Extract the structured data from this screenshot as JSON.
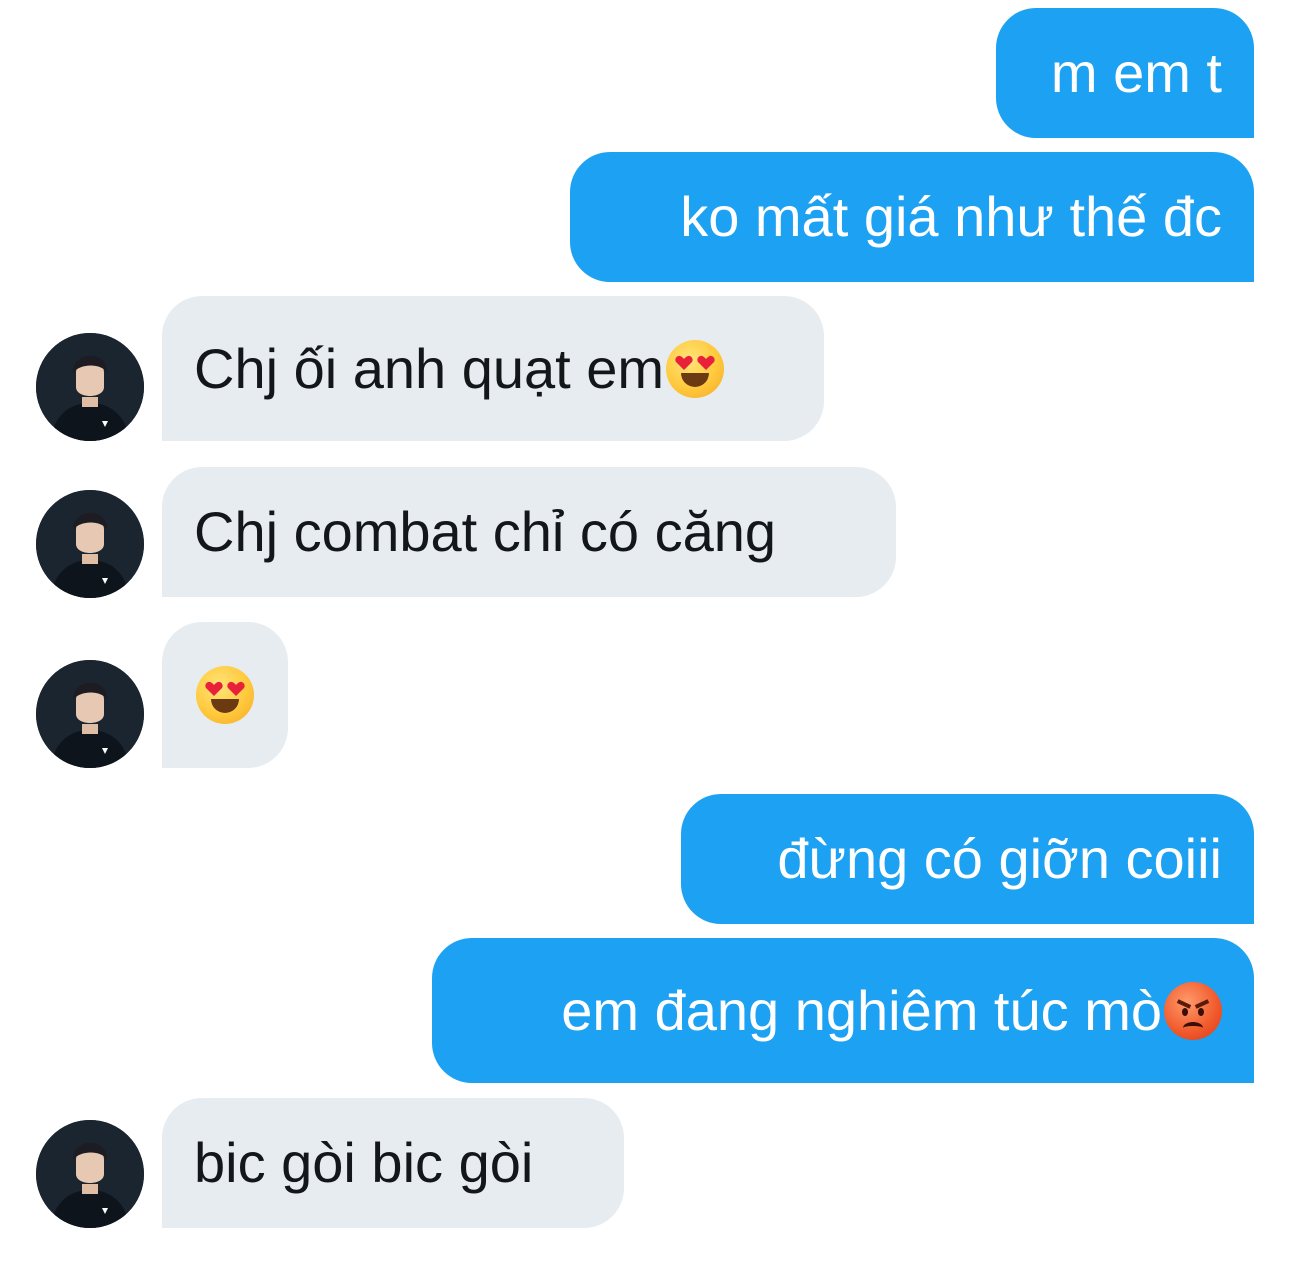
{
  "conversation": {
    "messages": [
      {
        "side": "out",
        "text": "m em t",
        "emoji": ""
      },
      {
        "side": "out",
        "text": "ko mất giá như thế đc",
        "emoji": ""
      },
      {
        "side": "in",
        "text": "Chj ối anh quạt em",
        "emoji": "heart-eyes-emoji"
      },
      {
        "side": "in",
        "text": "Chj combat chỉ có căng",
        "emoji": ""
      },
      {
        "side": "in",
        "text": "",
        "emoji": "heart-eyes-emoji"
      },
      {
        "side": "out",
        "text": "đừng có giỡn coiii",
        "emoji": ""
      },
      {
        "side": "out",
        "text": "em đang nghiêm túc mò",
        "emoji": "angry-face-emoji"
      },
      {
        "side": "in",
        "text": "bic gòi bic gòi",
        "emoji": ""
      }
    ]
  },
  "colors": {
    "outgoing_bubble": "#1da1f2",
    "incoming_bubble": "#e6ecf0",
    "incoming_text": "#14171a",
    "outgoing_text": "#ffffff"
  }
}
